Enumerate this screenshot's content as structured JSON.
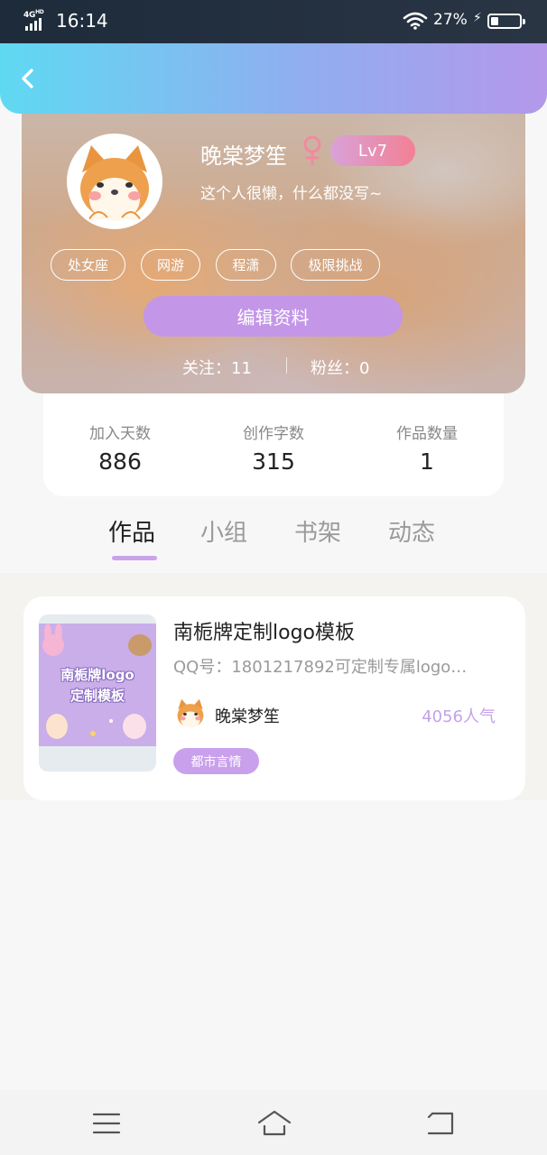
{
  "status_bar": {
    "network": "4G",
    "network_sup": "HD",
    "time": "16:14",
    "battery_percent": "27%",
    "battery_level": 0.27,
    "icons": [
      "signal-icon",
      "wifi-icon",
      "charging-icon",
      "battery-icon"
    ]
  },
  "header": {
    "back_icon": "chevron-left-icon"
  },
  "profile": {
    "name": "晚棠梦笙",
    "gender_icon": "female-icon",
    "level": "Lv7",
    "bio": "这个人很懒，什么都没写~",
    "tags": [
      "处女座",
      "网游",
      "程潇",
      "极限挑战"
    ],
    "edit_button": "编辑资料",
    "follow_text": "关注：11",
    "fans_text": "粉丝：0"
  },
  "stats": [
    {
      "label": "加入天数",
      "value": "886"
    },
    {
      "label": "创作字数",
      "value": "315"
    },
    {
      "label": "作品数量",
      "value": "1"
    }
  ],
  "tabs": [
    {
      "label": "作品",
      "active": true
    },
    {
      "label": "小组",
      "active": false
    },
    {
      "label": "书架",
      "active": false
    },
    {
      "label": "动态",
      "active": false
    }
  ],
  "works": [
    {
      "cover_text_line1": "南栀牌logo",
      "cover_text_line2": "定制模板",
      "title": "南栀牌定制logo模板",
      "description": "QQ号：1801217892可定制专属logo…",
      "author": "晚棠梦笙",
      "popularity": "4056人气",
      "genre": "都市言情"
    }
  ],
  "nav": {
    "icons": [
      "menu-icon",
      "home-icon",
      "back-icon"
    ]
  },
  "colors": {
    "accent_purple": "#c396e8",
    "header_start": "#5fd9f2",
    "header_end": "#b498ea",
    "level_start": "#d9a2d8",
    "level_end": "#f28094"
  }
}
